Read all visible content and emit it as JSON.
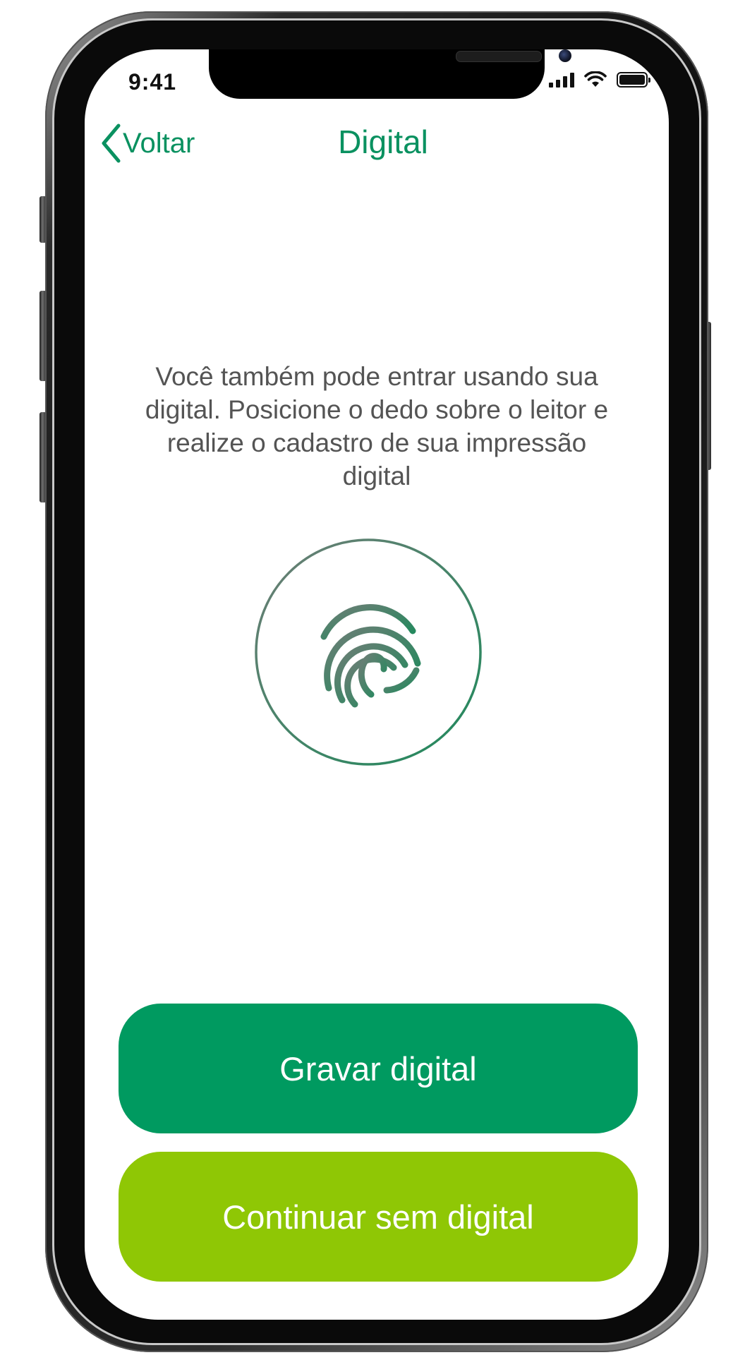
{
  "status_bar": {
    "time": "9:41"
  },
  "nav": {
    "back_label": "Voltar",
    "title": "Digital"
  },
  "content": {
    "instruction": "Você também pode entrar usando sua digital. Posicione o dedo sobre o leitor e realize o cadastro de sua impressão digital",
    "icon": "fingerprint-icon"
  },
  "buttons": {
    "primary_label": "Gravar digital",
    "secondary_label": "Continuar sem digital"
  },
  "colors": {
    "brand_green": "#009a60",
    "accent_lime": "#8fc705",
    "text_gray": "#545454",
    "fingerprint_gradient_start": "#6d7e76",
    "fingerprint_gradient_end": "#1f8a5c"
  }
}
